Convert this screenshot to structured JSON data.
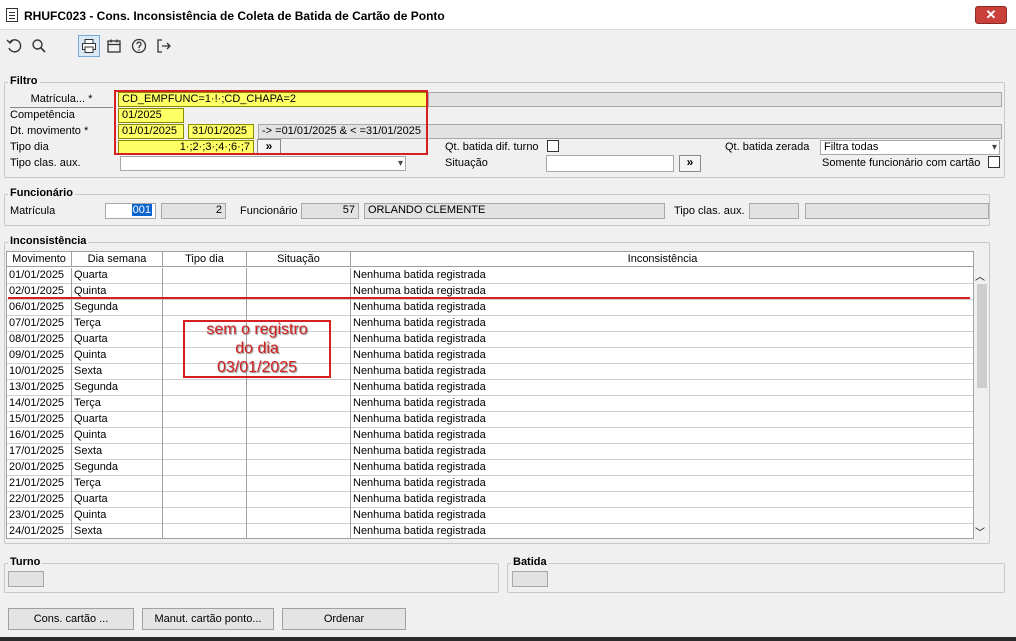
{
  "window": {
    "title": "RHUFC023 - Cons. Inconsistência de Coleta de Batida de Cartão de Ponto",
    "close_glyph": "✕"
  },
  "toolbar": [
    "undo-icon",
    "search-icon",
    "print-icon",
    "calendar-icon",
    "help-icon",
    "exit-icon"
  ],
  "filtro": {
    "title": "Filtro",
    "matricula_label": "Matrícula... *",
    "matricula_value": "CD_EMPFUNC=1·!·;CD_CHAPA=2",
    "competencia_label": "Competência",
    "competencia_value": "01/2025",
    "dt_movimento_label": "Dt. movimento *",
    "dt_inicio": "01/01/2025",
    "dt_fim": "31/01/2025",
    "dt_expr": "-> =01/01/2025 & < =31/01/2025",
    "tipo_dia_label": "Tipo dia",
    "tipo_dia_value": "1·;2·;3·;4·;6·;7",
    "lookup_glyph": "»",
    "tipo_clas_label": "Tipo clas. aux.",
    "qt_batida_dif_label": "Qt. batida dif. turno",
    "situacao_label": "Situação",
    "qt_batida_zerada_label": "Qt. batida zerada",
    "qt_batida_zerada_value": "Filtra todas",
    "somente_cartao_label": "Somente funcionário com cartão"
  },
  "funcionario": {
    "title": "Funcionário",
    "matricula_label": "Matrícula",
    "matricula_value": "001",
    "chapa_value": "2",
    "funcionario_label": "Funcionário",
    "funcionario_code": "57",
    "funcionario_name": "ORLANDO CLEMENTE",
    "tipo_clas_label": "Tipo clas. aux."
  },
  "inconsistencia": {
    "title": "Inconsistência",
    "columns": [
      "Movimento",
      "Dia semana",
      "Tipo dia",
      "Situação",
      "Inconsistência"
    ],
    "rows": [
      [
        "01/01/2025",
        "Quarta",
        "",
        "",
        "Nenhuma batida registrada"
      ],
      [
        "02/01/2025",
        "Quinta",
        "",
        "",
        "Nenhuma batida registrada"
      ],
      [
        "06/01/2025",
        "Segunda",
        "",
        "",
        "Nenhuma batida registrada"
      ],
      [
        "07/01/2025",
        "Terça",
        "",
        "",
        "Nenhuma batida registrada"
      ],
      [
        "08/01/2025",
        "Quarta",
        "",
        "",
        "Nenhuma batida registrada"
      ],
      [
        "09/01/2025",
        "Quinta",
        "",
        "",
        "Nenhuma batida registrada"
      ],
      [
        "10/01/2025",
        "Sexta",
        "",
        "",
        "Nenhuma batida registrada"
      ],
      [
        "13/01/2025",
        "Segunda",
        "",
        "",
        "Nenhuma batida registrada"
      ],
      [
        "14/01/2025",
        "Terça",
        "",
        "",
        "Nenhuma batida registrada"
      ],
      [
        "15/01/2025",
        "Quarta",
        "",
        "",
        "Nenhuma batida registrada"
      ],
      [
        "16/01/2025",
        "Quinta",
        "",
        "",
        "Nenhuma batida registrada"
      ],
      [
        "17/01/2025",
        "Sexta",
        "",
        "",
        "Nenhuma batida registrada"
      ],
      [
        "20/01/2025",
        "Segunda",
        "",
        "",
        "Nenhuma batida registrada"
      ],
      [
        "21/01/2025",
        "Terça",
        "",
        "",
        "Nenhuma batida registrada"
      ],
      [
        "22/01/2025",
        "Quarta",
        "",
        "",
        "Nenhuma batida registrada"
      ],
      [
        "23/01/2025",
        "Quinta",
        "",
        "",
        "Nenhuma batida registrada"
      ],
      [
        "24/01/2025",
        "Sexta",
        "",
        "",
        "Nenhuma batida registrada"
      ]
    ]
  },
  "annotation": {
    "line1": "sem o registro",
    "line2": "do dia",
    "line3": "03/01/2025",
    "color": "#d42020"
  },
  "turno": {
    "title": "Turno"
  },
  "batida": {
    "title": "Batida"
  },
  "buttons": {
    "cons_cartao": "Cons. cartão ...",
    "manut_cartao": "Manut. cartão ponto...",
    "ordenar": "Ordenar"
  }
}
